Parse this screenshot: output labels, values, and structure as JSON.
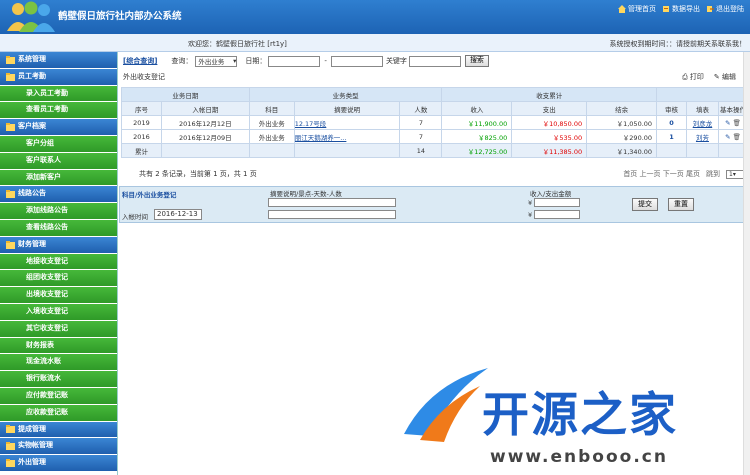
{
  "header": {
    "title": "鹤壁假日旅行社内部办公系统",
    "links": [
      {
        "label": "管理首页",
        "icon": "home-icon"
      },
      {
        "label": "数据导出",
        "icon": "export-icon"
      },
      {
        "label": "退出登陆",
        "icon": "logout-icon"
      }
    ]
  },
  "infobar": {
    "welcome": "欢迎您：鹤壁假日旅行社 [rt1y]",
    "license": "系统授权到期时间：：请授前期关系联系我！"
  },
  "sidebar": [
    {
      "type": "head",
      "label": "系统管理"
    },
    {
      "type": "head",
      "label": "员工考勤"
    },
    {
      "type": "item",
      "label": "录入员工考勤"
    },
    {
      "type": "item",
      "label": "查看员工考勤"
    },
    {
      "type": "head",
      "label": "客户档案"
    },
    {
      "type": "item",
      "label": "客户分组"
    },
    {
      "type": "item",
      "label": "客户联系人"
    },
    {
      "type": "item",
      "label": "添加新客户"
    },
    {
      "type": "head",
      "label": "线路公告"
    },
    {
      "type": "item",
      "label": "添加线路公告"
    },
    {
      "type": "item",
      "label": "查看线路公告"
    },
    {
      "type": "head",
      "label": "财务管理"
    },
    {
      "type": "item",
      "label": "地接收支登记"
    },
    {
      "type": "item",
      "label": "组团收支登记"
    },
    {
      "type": "item",
      "label": "出境收支登记"
    },
    {
      "type": "item",
      "label": "入境收支登记"
    },
    {
      "type": "item",
      "label": "其它收支登记"
    },
    {
      "type": "item",
      "label": "财务报表"
    },
    {
      "type": "item",
      "label": "现金流水账"
    },
    {
      "type": "item",
      "label": "银行账流水"
    },
    {
      "type": "item",
      "label": "应付款登记账"
    },
    {
      "type": "item",
      "label": "应收款登记账"
    },
    {
      "type": "head",
      "label": "提成管理"
    },
    {
      "type": "head",
      "label": "实物帐管理"
    },
    {
      "type": "head",
      "label": "外出管理"
    }
  ],
  "toolbar": {
    "query_tab": "[综合查询]",
    "query_label": "查询：",
    "query_select": "外出业务",
    "date_label": "日期：",
    "date_sep": "-",
    "keyword_label": "关键字",
    "search_button": "搜索"
  },
  "section": {
    "title": "外出收支登记",
    "print": "打印",
    "edit": "编辑"
  },
  "table": {
    "group_headers": [
      "业务日期",
      "业务类型",
      "收支累计"
    ],
    "headers": [
      "序号",
      "入帐日期",
      "科目",
      "摘要说明",
      "人数",
      "收入",
      "支出",
      "结余",
      "审核",
      "填表",
      "基本操作"
    ],
    "rows": [
      {
        "no": "2019",
        "date": "2016年12月12日",
        "subject": "外出业务",
        "desc": "12.17号段",
        "people": "7",
        "income": "￥11,900.00",
        "expense": "￥10,850.00",
        "balance": "￥1,050.00",
        "audit": "0",
        "filler": "刘彦龙"
      },
      {
        "no": "2016",
        "date": "2016年12月09日",
        "subject": "外出业务",
        "desc": "丽江天鹅湖养一...",
        "people": "7",
        "income": "￥825.00",
        "expense": "￥535.00",
        "balance": "￥290.00",
        "audit": "1",
        "filler": "刘芳"
      }
    ],
    "total": {
      "label": "累计",
      "people": "14",
      "income": "￥12,725.00",
      "expense": "￥11,385.00",
      "balance": "￥1,340.00"
    }
  },
  "pager": {
    "summary": "共有 2 条记录，当前第 1 页，共 1 页",
    "nav": "首页 上一页 下一页 尾页",
    "jump_label": "跳到",
    "page_value": "1"
  },
  "entry": {
    "title": "科目/外出业务登记",
    "desc_label": "摘要说明/景点-天数-人数",
    "amount_label": "收入/支出金额",
    "currency": "¥",
    "date_label": "入帐时间",
    "date_value": "2016-12-13",
    "submit_button": "提交",
    "reset_button": "重置"
  },
  "watermark": {
    "text": "开源之家",
    "url": "www.enbooo.cn"
  },
  "colors": {
    "header_blue": "#1d63b4",
    "side_green": "#2f9a28",
    "money_green": "#00a000",
    "money_red": "#e00000"
  }
}
